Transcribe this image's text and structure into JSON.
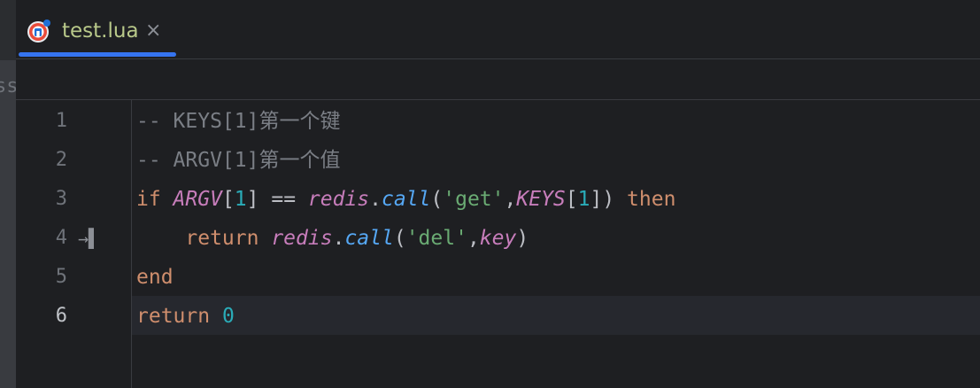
{
  "tab": {
    "label": "test.lua",
    "close_glyph": "×",
    "icon": "lua-file-icon"
  },
  "left_panel": {
    "text": "ss"
  },
  "editor": {
    "active_line": 6,
    "lines": [
      {
        "number": "1",
        "tokens": [
          {
            "t": "cmt",
            "v": "-- KEYS[1]第一个键"
          }
        ]
      },
      {
        "number": "2",
        "tokens": [
          {
            "t": "cmt",
            "v": "-- ARGV[1]第一个值"
          }
        ]
      },
      {
        "number": "3",
        "tokens": [
          {
            "t": "kw",
            "v": "if "
          },
          {
            "t": "glob",
            "v": "ARGV"
          },
          {
            "t": "op",
            "v": "["
          },
          {
            "t": "num",
            "v": "1"
          },
          {
            "t": "op",
            "v": "] == "
          },
          {
            "t": "glob",
            "v": "redis"
          },
          {
            "t": "op",
            "v": "."
          },
          {
            "t": "fn",
            "v": "call"
          },
          {
            "t": "op",
            "v": "("
          },
          {
            "t": "str",
            "v": "'get'"
          },
          {
            "t": "op",
            "v": ","
          },
          {
            "t": "glob",
            "v": "KEYS"
          },
          {
            "t": "op",
            "v": "["
          },
          {
            "t": "num",
            "v": "1"
          },
          {
            "t": "op",
            "v": "]) "
          },
          {
            "t": "kw",
            "v": "then"
          }
        ]
      },
      {
        "number": "4",
        "tab_marker": "→▌",
        "tokens": [
          {
            "t": "op",
            "v": "    "
          },
          {
            "t": "kw",
            "v": "return "
          },
          {
            "t": "glob",
            "v": "redis"
          },
          {
            "t": "op",
            "v": "."
          },
          {
            "t": "fn",
            "v": "call"
          },
          {
            "t": "op",
            "v": "("
          },
          {
            "t": "str",
            "v": "'del'"
          },
          {
            "t": "op",
            "v": ","
          },
          {
            "t": "glob",
            "v": "key"
          },
          {
            "t": "op",
            "v": ")"
          }
        ]
      },
      {
        "number": "5",
        "tokens": [
          {
            "t": "kw",
            "v": "end"
          }
        ]
      },
      {
        "number": "6",
        "tokens": [
          {
            "t": "kw",
            "v": "return "
          },
          {
            "t": "num",
            "v": "0"
          }
        ]
      }
    ]
  },
  "colors": {
    "background": "#1e1f22",
    "tab_accent": "#3574f0",
    "keyword": "#cf8e6d",
    "comment": "#7a7e85",
    "global": "#c77dbb",
    "function": "#56a8f5",
    "number": "#2aacb8",
    "string": "#6aab73"
  }
}
